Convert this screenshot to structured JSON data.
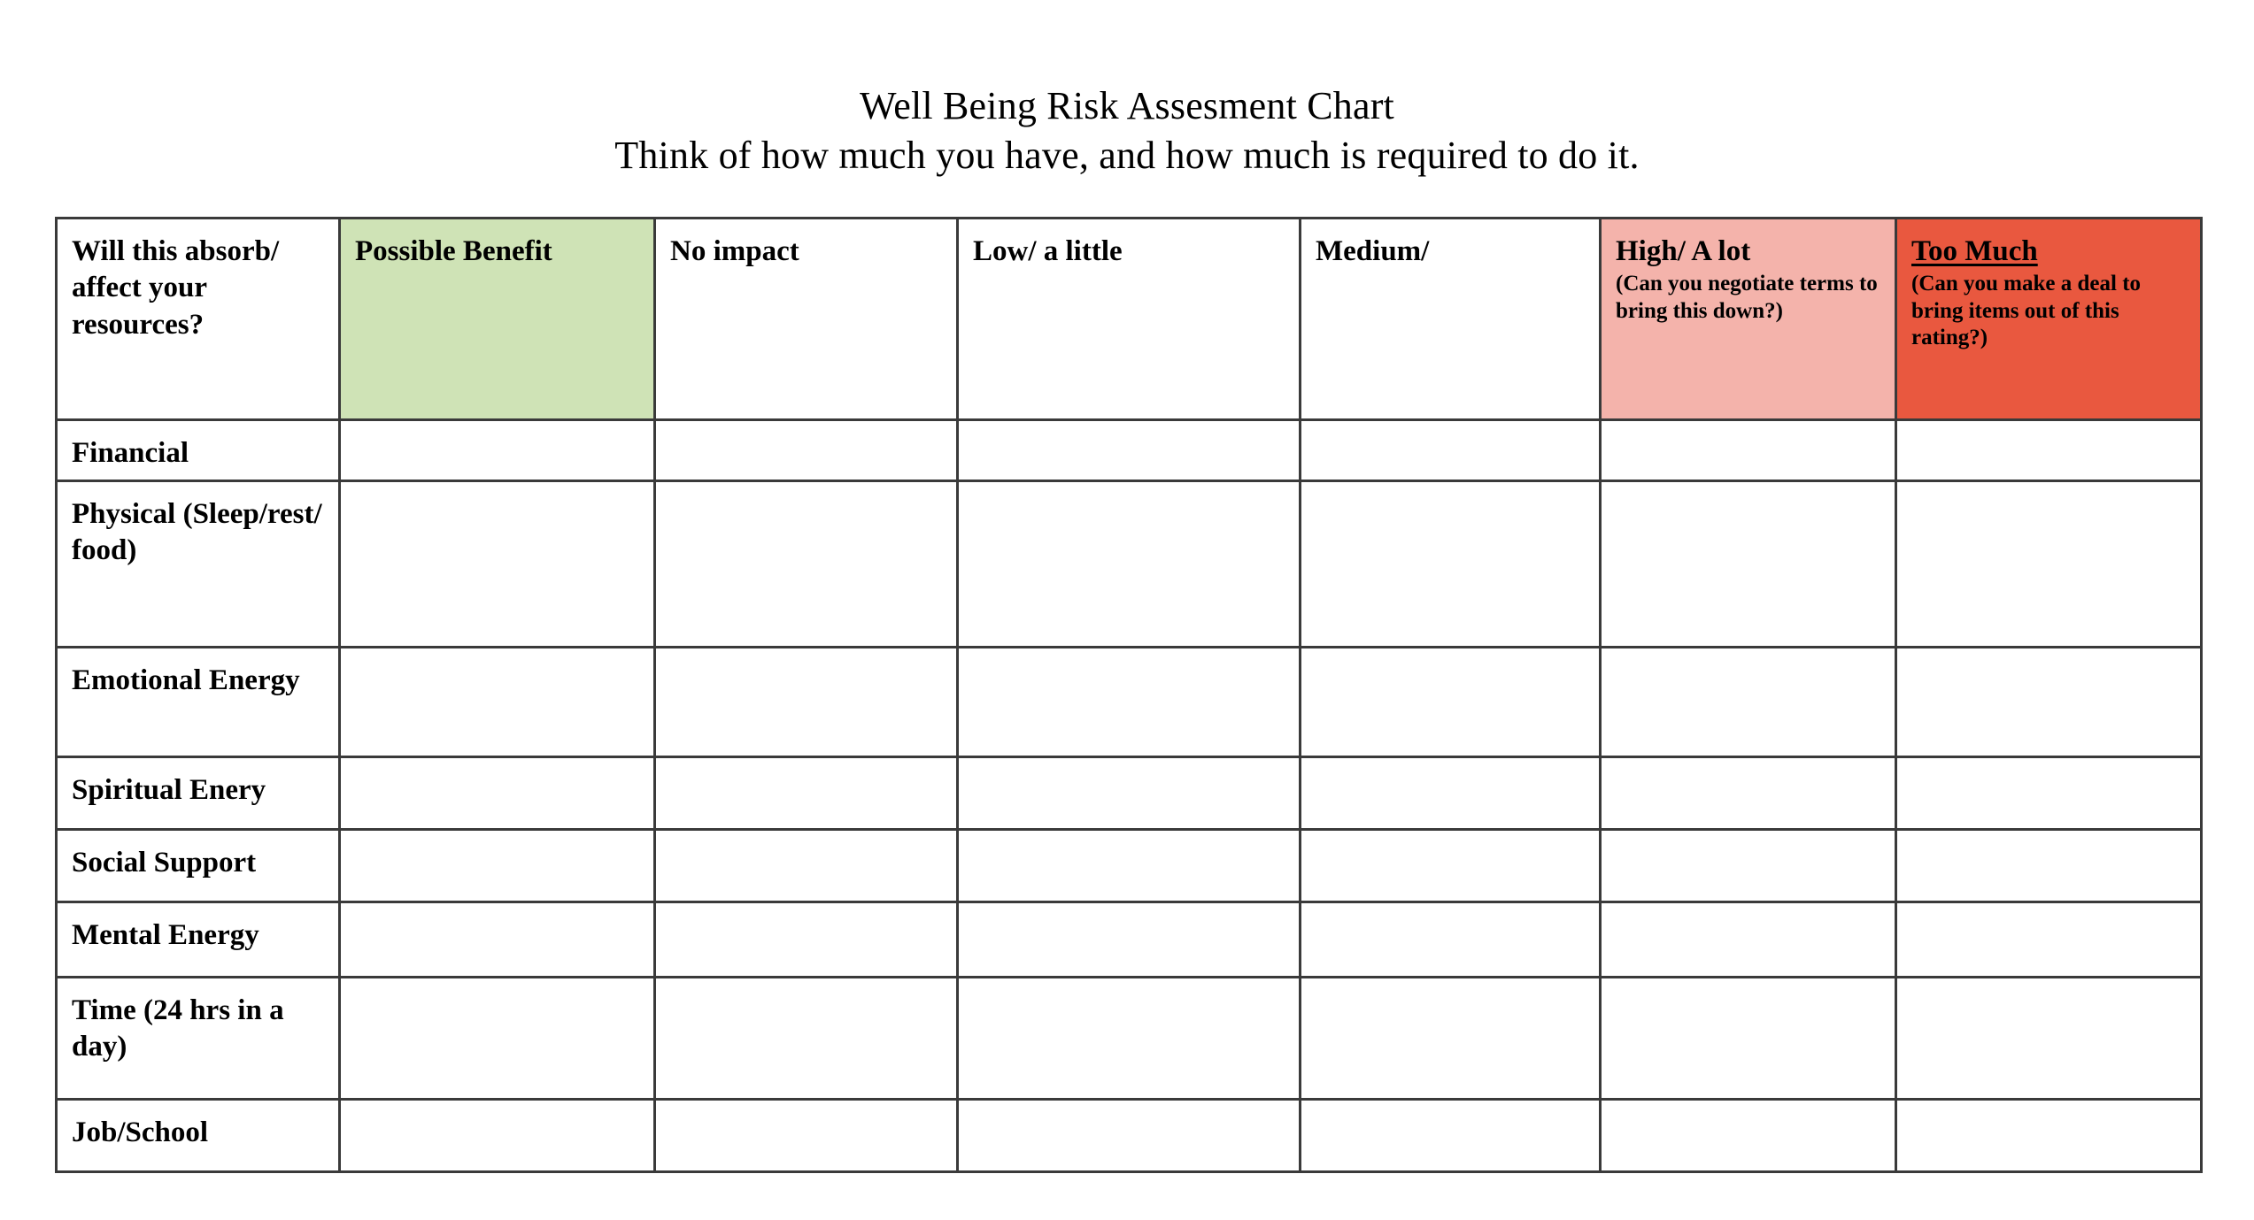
{
  "document": {
    "title_line_1": "Well Being Risk Assesment Chart",
    "title_line_2": "Think of how much you have, and how much is required to do it."
  },
  "table": {
    "columns": [
      {
        "key": "label",
        "label": "Will this absorb/ affect your resources?",
        "sublabel": "",
        "fill": "#ffffff",
        "underline": false
      },
      {
        "key": "benefit",
        "label": "Possible Benefit",
        "sublabel": "",
        "fill": "#cfe3b6",
        "underline": false
      },
      {
        "key": "none",
        "label": "No impact",
        "sublabel": "",
        "fill": "#ffffff",
        "underline": false
      },
      {
        "key": "low",
        "label": "Low/ a little",
        "sublabel": "",
        "fill": "#ffffff",
        "underline": false
      },
      {
        "key": "medium",
        "label": "Medium/",
        "sublabel": "",
        "fill": "#ffffff",
        "underline": false
      },
      {
        "key": "high",
        "label": "High/ A lot",
        "sublabel": "(Can you negotiate terms to bring this down?)",
        "fill": "#f4b3ab",
        "underline": false
      },
      {
        "key": "toomuch",
        "label": "Too Much",
        "sublabel": "(Can you make a deal to bring items out of this rating?)",
        "fill": "#e9583f",
        "underline": true
      }
    ],
    "rows": [
      {
        "label": "Financial"
      },
      {
        "label": "Physical (Sleep/rest/ food)"
      },
      {
        "label": "Emotional Energy"
      },
      {
        "label": "Spiritual Enery"
      },
      {
        "label": "Social Support"
      },
      {
        "label": "Mental Energy"
      },
      {
        "label": "Time (24 hrs in a day)"
      },
      {
        "label": "Job/School"
      }
    ]
  },
  "colors": {
    "benefit_green": "#cfe3b6",
    "high_pink": "#f4b3ab",
    "too_much_red": "#e9583f",
    "border": "#3a3a3a",
    "page_background": "#ffffff",
    "text": "#000000"
  }
}
